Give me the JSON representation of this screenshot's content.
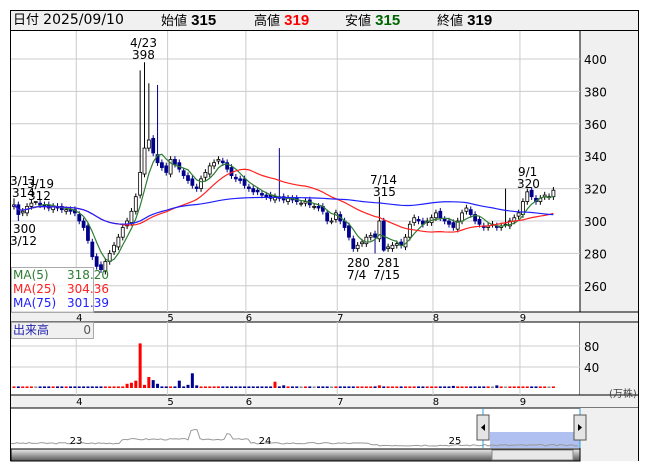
{
  "header": {
    "date_label": "日付",
    "date": "2025/09/10",
    "open_label": "始値",
    "open": "315",
    "high_label": "高値",
    "high": "319",
    "low_label": "安値",
    "low": "315",
    "close_label": "終値",
    "close": "319"
  },
  "colors": {
    "up": "#ffffff",
    "down": "#00008b",
    "ma5": "#2e7d32",
    "ma25": "#ff2020",
    "ma75": "#2020ff",
    "vol_up": "#ff0000",
    "vol_down": "#000090",
    "vol_flat": "#909090",
    "high_text": "#ff0000",
    "low_text": "#006400"
  },
  "annotations": {
    "a1": "3/11",
    "a2": "314",
    "a3": "3/19",
    "a4": "312",
    "a5": "300",
    "a6": "3/12",
    "a7": "4/23",
    "a8": "398",
    "a9": "7/14",
    "a10": "315",
    "a11": "280",
    "a12": "7/4",
    "a13": "281",
    "a14": "7/15",
    "a15": "9/1",
    "a16": "320"
  },
  "legend": {
    "ma5_label": "MA(5)",
    "ma5": "318.20",
    "ma25_label": "MA(25)",
    "ma25": "304.36",
    "ma75_label": "MA(75)",
    "ma75": "301.39"
  },
  "volume": {
    "label": "出来高",
    "value": "0",
    "unit": "(万株)"
  },
  "navigator": {
    "years": [
      "23",
      "24",
      "25"
    ]
  },
  "chart_data": {
    "type": "candlestick",
    "price_axis": {
      "ticks": [
        "400",
        "380",
        "360",
        "340",
        "320",
        "300",
        "280",
        "260"
      ],
      "range": [
        250,
        415
      ]
    },
    "volume_axis": {
      "ticks": [
        "80",
        "40"
      ],
      "range": [
        0,
        100
      ]
    },
    "month_ticks": [
      "4",
      "5",
      "6",
      "7",
      "8",
      "9"
    ],
    "month_start_index": [
      15,
      36,
      54,
      75,
      97,
      117
    ],
    "closes": [
      310,
      304,
      306,
      309,
      311,
      312,
      310,
      309,
      308,
      309,
      308,
      307,
      307,
      306,
      305,
      300,
      296,
      288,
      278,
      272,
      270,
      275,
      280,
      285,
      290,
      296,
      300,
      306,
      315,
      330,
      345,
      350,
      342,
      336,
      333,
      330,
      338,
      335,
      332,
      328,
      325,
      322,
      320,
      326,
      330,
      334,
      336,
      338,
      336,
      332,
      328,
      326,
      325,
      322,
      320,
      318,
      318,
      316,
      315,
      314,
      315,
      314,
      313,
      314,
      313,
      312,
      311,
      312,
      310,
      309,
      308,
      306,
      300,
      300,
      305,
      300,
      296,
      290,
      283,
      285,
      287,
      290,
      291,
      290,
      300,
      282,
      284,
      285,
      286,
      285,
      290,
      298,
      302,
      300,
      298,
      300,
      302,
      305,
      302,
      300,
      298,
      296,
      300,
      305,
      308,
      304,
      300,
      298,
      296,
      297,
      298,
      296,
      297,
      298,
      300,
      302,
      305,
      312,
      318,
      315,
      312,
      314,
      316,
      315,
      319
    ],
    "high_overrides": {
      "0": 314,
      "5": 312,
      "29": 393,
      "30": 398,
      "31": 385,
      "33": 384,
      "61": 345,
      "84": 315,
      "113": 320,
      "118": 320
    },
    "low_overrides": {
      "1": 300,
      "83": 280,
      "85": 281
    },
    "volumes_default": 3,
    "volume_overrides": {
      "26": 8,
      "27": 10,
      "28": 14,
      "29": 85,
      "30": 6,
      "31": 21,
      "32": 15,
      "33": 8,
      "38": 14,
      "40": 6,
      "41": 28,
      "42": 5,
      "60": 12,
      "62": 5,
      "84": 5,
      "101": 4,
      "111": 5
    }
  }
}
